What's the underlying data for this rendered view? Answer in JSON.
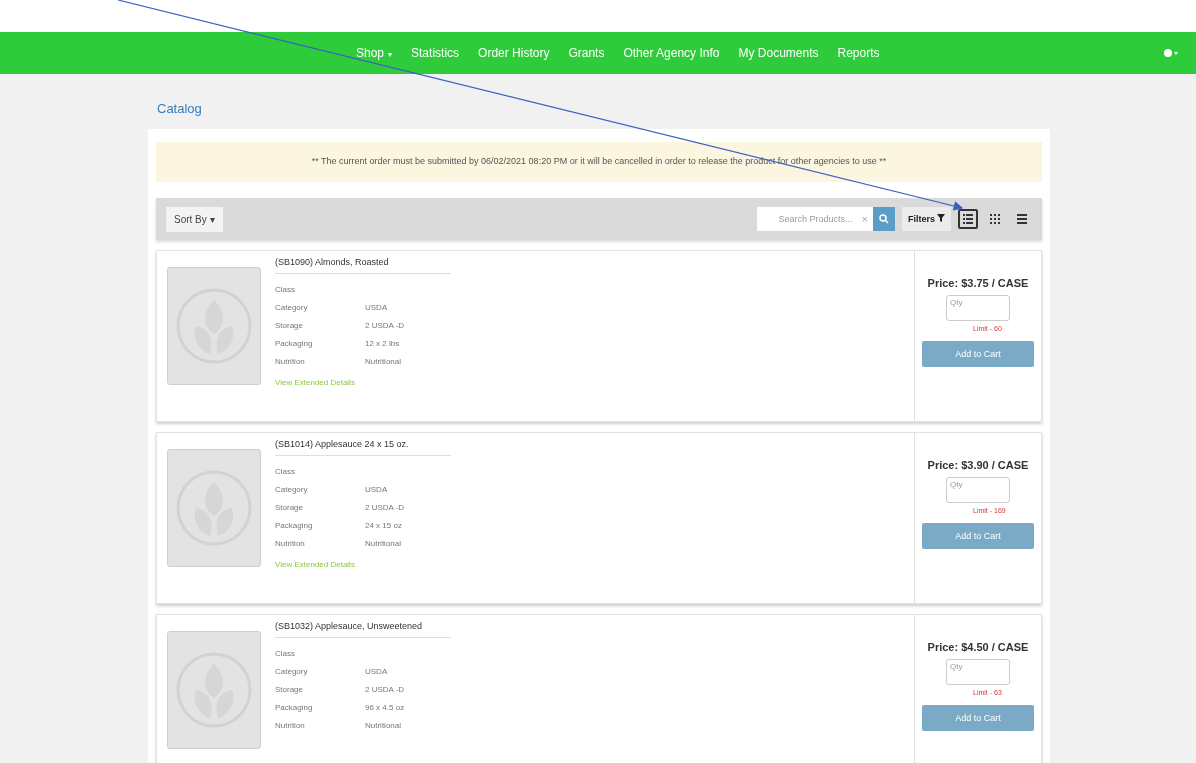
{
  "nav": {
    "items": [
      {
        "label": "Shop",
        "caret": "▾"
      },
      {
        "label": "Statistics"
      },
      {
        "label": "Order History"
      },
      {
        "label": "Grants"
      },
      {
        "label": "Other Agency Info"
      },
      {
        "label": "My Documents"
      },
      {
        "label": "Reports"
      }
    ]
  },
  "breadcrumb": "Catalog",
  "notice": "** The current order must be submitted by 06/02/2021 08:20 PM or it will be cancelled in order to release the product for other agencies to use **",
  "toolbar": {
    "sort": "Sort By",
    "sort_caret": "▾",
    "search": {
      "placeholder": "Search Products..."
    },
    "clear": "×",
    "filters": "Filters",
    "views": [
      {
        "kind": "list",
        "selected": true
      },
      {
        "kind": "grid",
        "selected": false
      },
      {
        "kind": "compact",
        "selected": false
      }
    ]
  },
  "products": [
    {
      "title": "(SB1090) Almonds, Roasted",
      "fields": [
        {
          "label": "Class"
        },
        {
          "label": "Category",
          "value": "USDA"
        },
        {
          "label": "Storage",
          "value": "2 USDA -D"
        },
        {
          "label": "Packaging",
          "value": "12 x 2 lbs"
        },
        {
          "label": "Nutrition",
          "value": "Nutritional"
        }
      ],
      "link": "View Extended Details",
      "price": "Price: $3.75 / CASE",
      "qty_placeholder": "Qty",
      "limit": "Limit - 60",
      "button": "Add to Cart"
    },
    {
      "title": "(SB1014) Applesauce 24 x 15 oz.",
      "fields": [
        {
          "label": "Class"
        },
        {
          "label": "Category",
          "value": "USDA"
        },
        {
          "label": "Storage",
          "value": "2 USDA -D"
        },
        {
          "label": "Packaging",
          "value": "24 x 15 oz"
        },
        {
          "label": "Nutrition",
          "value": "Nutritional"
        }
      ],
      "link": "View Extended Details",
      "price": "Price: $3.90 / CASE",
      "qty_placeholder": "Qty",
      "limit": "Limit - 169",
      "button": "Add to Cart"
    },
    {
      "title": "(SB1032) Applesauce, Unsweetened",
      "fields": [
        {
          "label": "Class"
        },
        {
          "label": "Category",
          "value": "USDA"
        },
        {
          "label": "Storage",
          "value": "2 USDA -D"
        },
        {
          "label": "Packaging",
          "value": "96 x 4.5 oz"
        },
        {
          "label": "Nutrition",
          "value": "Nutritional"
        }
      ],
      "price": "Price: $4.50 / CASE",
      "qty_placeholder": "Qty",
      "limit": "Limit - 63",
      "button": "Add to Cart"
    }
  ]
}
